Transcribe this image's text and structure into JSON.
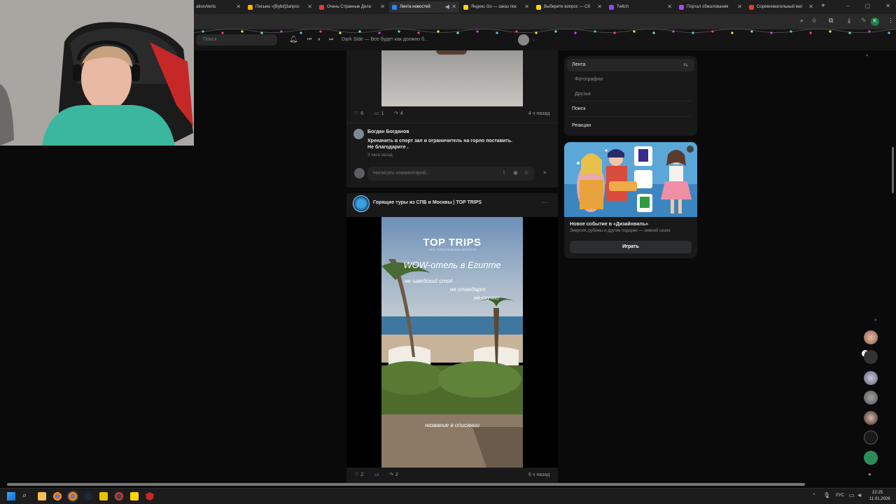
{
  "browser": {
    "tabs": [
      {
        "label": "ationAlerts",
        "color": "#1f1f1f"
      },
      {
        "label": "Письмо «[Bybit]Запрос",
        "color": "#f4b400"
      },
      {
        "label": "Очень Странные Дела",
        "color": "#e53935"
      },
      {
        "label": "Лента новостей",
        "color": "#2787f5"
      },
      {
        "label": "Яндекс Go — заказ пок",
        "color": "#ffd600"
      },
      {
        "label": "Выберите вопрос — Сб",
        "color": "#ffd600"
      },
      {
        "label": "Twitch",
        "color": "#9146ff"
      },
      {
        "label": "Портал обжалования",
        "color": "#9c4dff"
      },
      {
        "label": "Соревновательный мат",
        "color": "#e53935"
      }
    ],
    "new_tab": "+",
    "profile_initial": "K"
  },
  "header": {
    "search_placeholder": "Поиск",
    "player_track": "Dark Side — Все будет как должно б..."
  },
  "post1": {
    "likes": "6",
    "comments": "1",
    "shares": "4",
    "time": "4 ч назад",
    "comment": {
      "author": "Богдан Богданов",
      "text_line1": "Хреначить в спорт зал и ограничитель на горло поставить.",
      "text_line2": "Не благодарите .",
      "time": "3 часа назад"
    },
    "comment_placeholder": "Написать комментарий..."
  },
  "post2": {
    "author": "Горящие туры из СПБ и Москвы | TOP TRIPS",
    "media": {
      "logo": "TOP TRIPS",
      "logo_sub": "СЕТЬ ТУРИСТИЧЕСКИХ АГЕНТСТВ",
      "headline": "WOW-отель в Египте",
      "line1": "не шведский стол",
      "line2": "не стандарт",
      "line3": "не скучно",
      "footer": "название в описании"
    },
    "likes": "2",
    "shares": "2",
    "time": "6 ч назад"
  },
  "sidebar_menu": {
    "items": [
      {
        "label": "Лента"
      },
      {
        "label": "Фотографии"
      },
      {
        "label": "Друзья"
      },
      {
        "label": "Поиск"
      },
      {
        "label": "Реакции"
      }
    ]
  },
  "promo": {
    "game_title": "Дизайнвиль",
    "title": "Новое событие в «Дизайнвиль»",
    "subtitle": "Энергия, рубины и другие подарки — зимний сезон",
    "button": "Играть"
  },
  "dock": {
    "badge": "1"
  },
  "taskbar": {
    "lang": "РУС",
    "time": "22:25",
    "date": "11.01.2026"
  }
}
